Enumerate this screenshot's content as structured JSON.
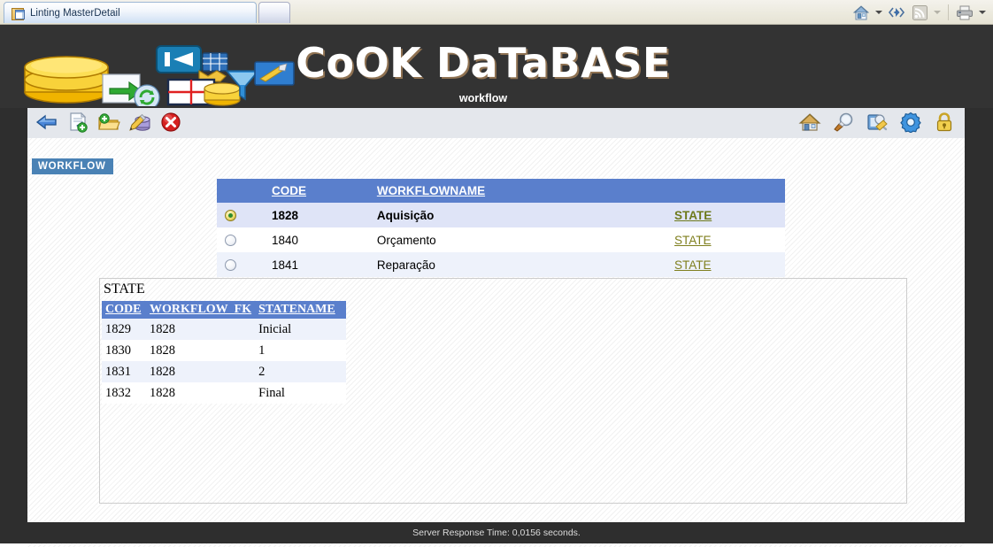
{
  "browser": {
    "tabs": [
      {
        "title": "Linting MasterDetail",
        "icon": "page-window-icon",
        "active": true
      },
      {
        "title": "",
        "icon": "new-tab-icon",
        "active": false
      }
    ],
    "tools": [
      {
        "name": "home-button",
        "icon": "home-icon",
        "label": "Home"
      },
      {
        "name": "home-dropdown",
        "icon": "chevron-down-icon",
        "label": ""
      },
      {
        "name": "feeds-button",
        "icon": "feed-discovery-icon",
        "label": "Feeds"
      },
      {
        "name": "rss-button",
        "icon": "rss-icon",
        "label": "RSS"
      },
      {
        "name": "rss-dropdown",
        "icon": "chevron-down-icon",
        "label": ""
      },
      {
        "name": "print-button",
        "icon": "printer-icon",
        "label": "Print"
      },
      {
        "name": "print-dropdown",
        "icon": "chevron-down-icon",
        "label": ""
      }
    ]
  },
  "banner": {
    "title": "CoOK DaTaBASE",
    "subtitle": "workflow",
    "logo_icons": [
      "database-cylinder-icon",
      "import-arrow-icon",
      "refresh-icon",
      "first-record-icon",
      "grid-table-icon",
      "spreadsheet-database-icon",
      "filter-funnel-icon",
      "tools-wrench-icon"
    ]
  },
  "toolbar": {
    "left_buttons": [
      {
        "name": "back-button",
        "icon": "back-arrow-icon",
        "title": "Back"
      },
      {
        "name": "new-record-button",
        "icon": "new-document-icon",
        "title": "New"
      },
      {
        "name": "open-folder-button",
        "icon": "open-folder-icon",
        "title": "Open"
      },
      {
        "name": "edit-record-button",
        "icon": "edit-database-icon",
        "title": "Edit"
      },
      {
        "name": "delete-record-button",
        "icon": "delete-icon",
        "title": "Delete"
      }
    ],
    "right_buttons": [
      {
        "name": "home-button",
        "icon": "home-icon",
        "title": "Home"
      },
      {
        "name": "search-button",
        "icon": "search-brush-icon",
        "title": "Search"
      },
      {
        "name": "reports-button",
        "icon": "reports-icon",
        "title": "Reports"
      },
      {
        "name": "settings-button",
        "icon": "gear-icon",
        "title": "Settings"
      },
      {
        "name": "security-button",
        "icon": "lock-icon",
        "title": "Security"
      }
    ]
  },
  "breadcrumb": {
    "label": "WORKFLOW"
  },
  "master": {
    "columns": [
      "",
      "CODE",
      "WORKFLOWNAME",
      ""
    ],
    "rows": [
      {
        "selected": true,
        "code": "1828",
        "name": "Aquisição",
        "link": "STATE"
      },
      {
        "selected": false,
        "code": "1840",
        "name": "Orçamento",
        "link": "STATE"
      },
      {
        "selected": false,
        "code": "1841",
        "name": "Reparação",
        "link": "STATE"
      }
    ]
  },
  "detail": {
    "caption": "STATE",
    "columns": [
      "CODE",
      "WORKFLOW_FK",
      "STATENAME"
    ],
    "rows": [
      {
        "code": "1829",
        "workflow_fk": "1828",
        "statename": "Inicial"
      },
      {
        "code": "1830",
        "workflow_fk": "1828",
        "statename": "1"
      },
      {
        "code": "1831",
        "workflow_fk": "1828",
        "statename": "2"
      },
      {
        "code": "1832",
        "workflow_fk": "1828",
        "statename": "Final"
      }
    ]
  },
  "footer": {
    "status": "Server Response Time: 0,0156 seconds."
  },
  "colors": {
    "banner_bg": "#333333",
    "table_header": "#5a7fcc",
    "breadcrumb_bg": "#4a82b5",
    "link": "#7f7f1e",
    "selected_row": "#dfe4f7",
    "alt_row": "#eef2fb",
    "toolbar_bg": "#e4e7ec",
    "frame": "#2e2e2e"
  }
}
